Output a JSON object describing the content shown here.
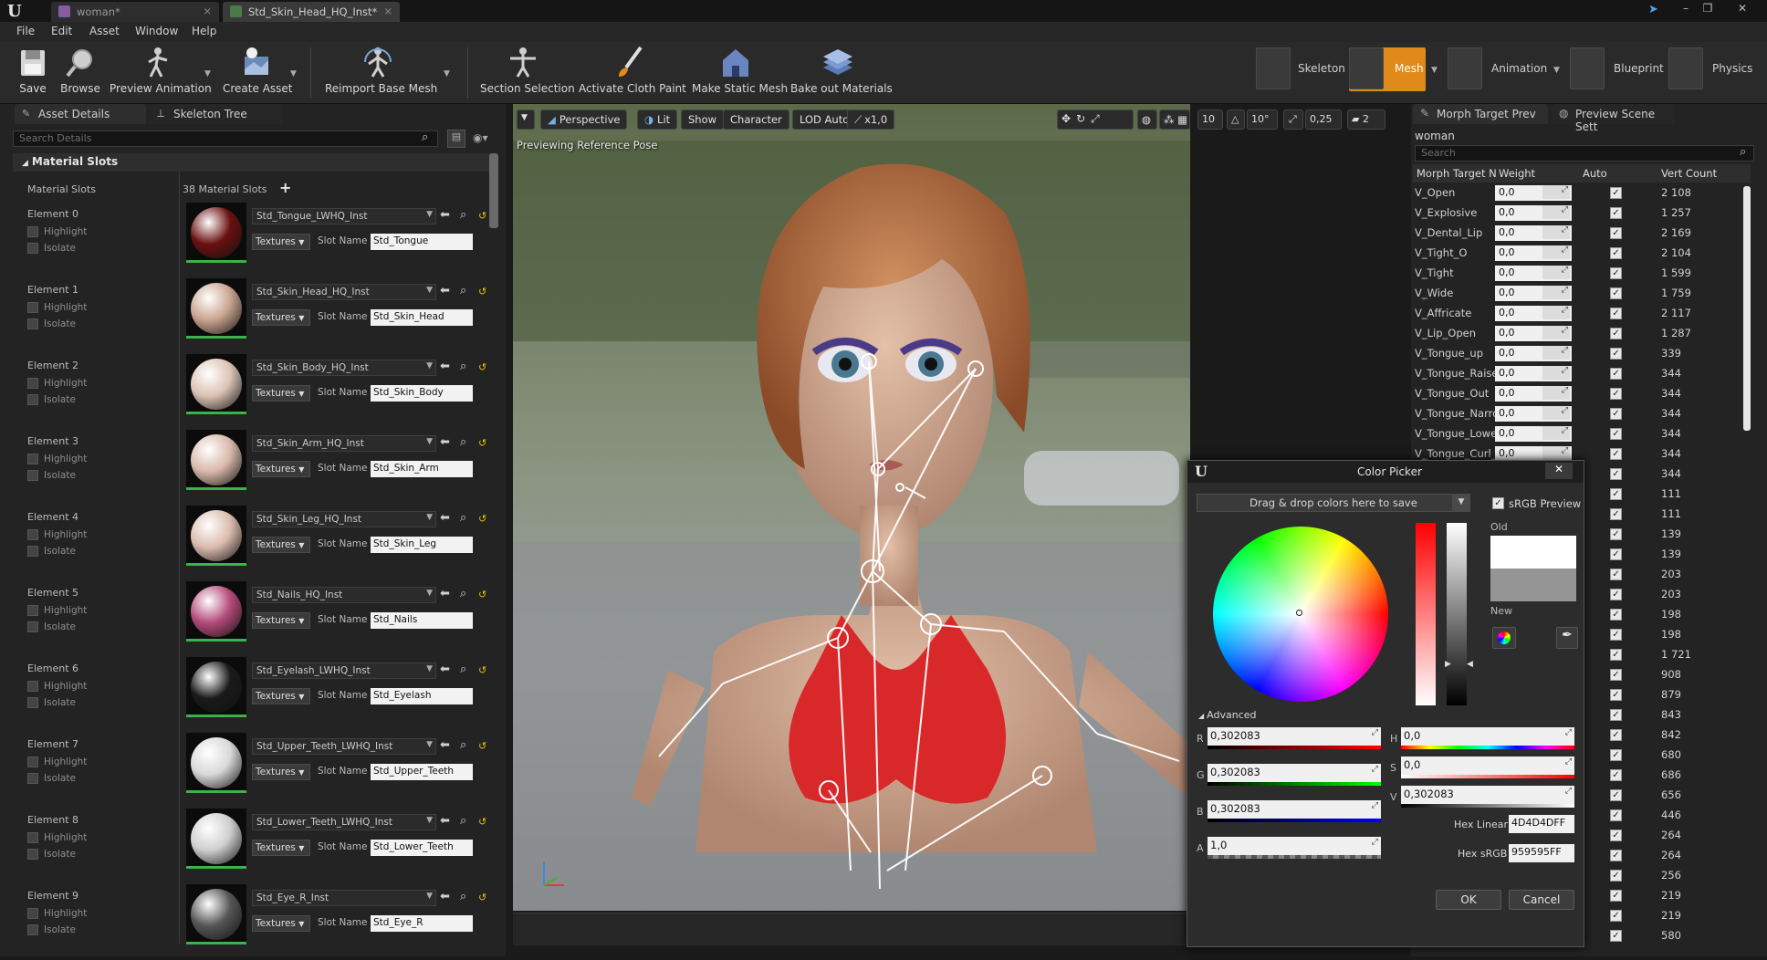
{
  "titlebar": {
    "tabs": [
      {
        "label": "woman*"
      },
      {
        "label": "Std_Skin_Head_HQ_Inst*"
      }
    ],
    "min": "–",
    "max": "❐",
    "close": "✕",
    "logo": "U"
  },
  "menubar": {
    "items": [
      "File",
      "Edit",
      "Asset",
      "Window",
      "Help"
    ]
  },
  "toolbar": {
    "buttons": [
      {
        "label": "Save"
      },
      {
        "label": "Browse"
      },
      {
        "label": "Preview Animation"
      },
      {
        "label": "Create Asset"
      },
      {
        "label": "Reimport Base Mesh"
      },
      {
        "label": "Section Selection"
      },
      {
        "label": "Activate Cloth Paint"
      },
      {
        "label": "Make Static Mesh"
      },
      {
        "label": "Bake out Materials"
      }
    ],
    "modes": [
      {
        "label": "Skeleton"
      },
      {
        "label": "Mesh"
      },
      {
        "label": "Animation"
      },
      {
        "label": "Blueprint"
      },
      {
        "label": "Physics"
      }
    ]
  },
  "left": {
    "tabs": [
      {
        "label": "Asset Details"
      },
      {
        "label": "Skeleton Tree"
      }
    ],
    "search_placeholder": "Search Details",
    "section": "Material Slots",
    "slots_label": "Material Slots",
    "slots_count": "38 Material Slots",
    "add": "+",
    "highlight": "Highlight",
    "isolate": "Isolate",
    "textures": "Textures",
    "slot_name_label": "Slot Name",
    "elements": [
      {
        "label": "Element 0",
        "material": "Std_Tongue_LWHQ_Inst",
        "slot": "Std_Tongue",
        "color": "#6a1010"
      },
      {
        "label": "Element 1",
        "material": "Std_Skin_Head_HQ_Inst",
        "slot": "Std_Skin_Head",
        "color": "#c9a48e"
      },
      {
        "label": "Element 2",
        "material": "Std_Skin_Body_HQ_Inst",
        "slot": "Std_Skin_Body",
        "color": "#dcc3b4"
      },
      {
        "label": "Element 3",
        "material": "Std_Skin_Arm_HQ_Inst",
        "slot": "Std_Skin_Arm",
        "color": "#d9b9aa"
      },
      {
        "label": "Element 4",
        "material": "Std_Skin_Leg_HQ_Inst",
        "slot": "Std_Skin_Leg",
        "color": "#dcbcae"
      },
      {
        "label": "Element 5",
        "material": "Std_Nails_HQ_Inst",
        "slot": "Std_Nails",
        "color": "#b44a7a"
      },
      {
        "label": "Element 6",
        "material": "Std_Eyelash_LWHQ_Inst",
        "slot": "Std_Eyelash",
        "color": "#1a1a1a"
      },
      {
        "label": "Element 7",
        "material": "Std_Upper_Teeth_LWHQ_Inst",
        "slot": "Std_Upper_Teeth",
        "color": "#d8d8d8"
      },
      {
        "label": "Element 8",
        "material": "Std_Lower_Teeth_LWHQ_Inst",
        "slot": "Std_Lower_Teeth",
        "color": "#cfcfcf"
      },
      {
        "label": "Element 9",
        "material": "Std_Eye_R_Inst",
        "slot": "Std_Eye_R",
        "color": "#555555"
      }
    ]
  },
  "viewport": {
    "perspective": "Perspective",
    "lit": "Lit",
    "show": "Show",
    "character": "Character",
    "lod": "LOD Auto",
    "speed": "x1,0",
    "status": "Previewing Reference Pose",
    "grid": "10",
    "angle": "10°",
    "scale": "0,25",
    "cam": "2"
  },
  "right": {
    "tabs": [
      {
        "label": "Morph Target Prev"
      },
      {
        "label": "Preview Scene Sett"
      }
    ],
    "asset": "woman",
    "search_placeholder": "Search",
    "headers": {
      "name": "Morph Target N",
      "weight": "Weight",
      "auto": "Auto",
      "vert": "Vert Count"
    },
    "morphs": [
      {
        "name": "V_Open",
        "weight": "0,0",
        "vert": "2 108"
      },
      {
        "name": "V_Explosive",
        "weight": "0,0",
        "vert": "1 257"
      },
      {
        "name": "V_Dental_Lip",
        "weight": "0,0",
        "vert": "2 169"
      },
      {
        "name": "V_Tight_O",
        "weight": "0,0",
        "vert": "2 104"
      },
      {
        "name": "V_Tight",
        "weight": "0,0",
        "vert": "1 599"
      },
      {
        "name": "V_Wide",
        "weight": "0,0",
        "vert": "1 759"
      },
      {
        "name": "V_Affricate",
        "weight": "0,0",
        "vert": "2 117"
      },
      {
        "name": "V_Lip_Open",
        "weight": "0,0",
        "vert": "1 287"
      },
      {
        "name": "V_Tongue_up",
        "weight": "0,0",
        "vert": "339"
      },
      {
        "name": "V_Tongue_Raise",
        "weight": "0,0",
        "vert": "344"
      },
      {
        "name": "V_Tongue_Out",
        "weight": "0,0",
        "vert": "344"
      },
      {
        "name": "V_Tongue_Narro",
        "weight": "0,0",
        "vert": "344"
      },
      {
        "name": "V_Tongue_Lowe",
        "weight": "0,0",
        "vert": "344"
      },
      {
        "name": "V_Tongue_Curl_L",
        "weight": "0,0",
        "vert": "344"
      },
      {
        "name": "",
        "weight": "",
        "vert": "344"
      },
      {
        "name": "",
        "weight": "",
        "vert": "111"
      },
      {
        "name": "",
        "weight": "",
        "vert": "111"
      },
      {
        "name": "",
        "weight": "",
        "vert": "139"
      },
      {
        "name": "",
        "weight": "",
        "vert": "139"
      },
      {
        "name": "",
        "weight": "",
        "vert": "203"
      },
      {
        "name": "",
        "weight": "",
        "vert": "203"
      },
      {
        "name": "",
        "weight": "",
        "vert": "198"
      },
      {
        "name": "",
        "weight": "",
        "vert": "198"
      },
      {
        "name": "",
        "weight": "",
        "vert": "1 721"
      },
      {
        "name": "",
        "weight": "",
        "vert": "908"
      },
      {
        "name": "",
        "weight": "",
        "vert": "879"
      },
      {
        "name": "",
        "weight": "",
        "vert": "843"
      },
      {
        "name": "",
        "weight": "",
        "vert": "842"
      },
      {
        "name": "",
        "weight": "",
        "vert": "680"
      },
      {
        "name": "",
        "weight": "",
        "vert": "686"
      },
      {
        "name": "",
        "weight": "",
        "vert": "656"
      },
      {
        "name": "",
        "weight": "",
        "vert": "446"
      },
      {
        "name": "",
        "weight": "",
        "vert": "264"
      },
      {
        "name": "",
        "weight": "",
        "vert": "264"
      },
      {
        "name": "",
        "weight": "",
        "vert": "256"
      },
      {
        "name": "",
        "weight": "",
        "vert": "219"
      },
      {
        "name": "",
        "weight": "",
        "vert": "219"
      },
      {
        "name": "",
        "weight": "",
        "vert": "580"
      }
    ]
  },
  "colorpicker": {
    "title": "Color Picker",
    "close": "✕",
    "themes": "Drag & drop colors here to save",
    "srgb": "sRGB Preview",
    "old": "Old",
    "new": "New",
    "advanced": "Advanced",
    "r_label": "R",
    "g_label": "G",
    "b_label": "B",
    "a_label": "A",
    "h_label": "H",
    "s_label": "S",
    "v_label": "V",
    "r": "0,302083",
    "g": "0,302083",
    "b": "0,302083",
    "a": "1,0",
    "h": "0,0",
    "s": "0,0",
    "v": "0,302083",
    "hex_linear_label": "Hex Linear",
    "hex_linear": "4D4D4DFF",
    "hex_srgb_label": "Hex sRGB",
    "hex_srgb": "959595FF",
    "ok": "OK",
    "cancel": "Cancel"
  }
}
